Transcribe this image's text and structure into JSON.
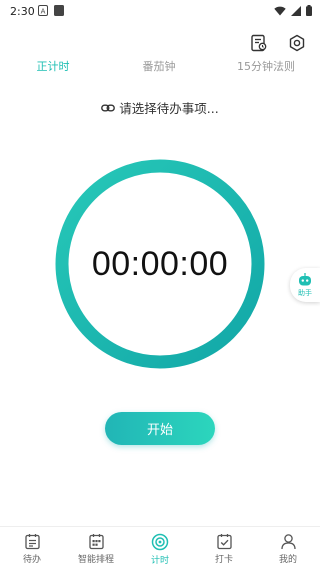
{
  "status_bar": {
    "time": "2:30"
  },
  "tabs": [
    {
      "label": "正计时",
      "active": true
    },
    {
      "label": "番茄钟",
      "active": false
    },
    {
      "label": "15分钟法则",
      "active": false
    }
  ],
  "task_select": {
    "label": "请选择待办事项..."
  },
  "timer": {
    "display": "00:00:00"
  },
  "assistant": {
    "label": "助手"
  },
  "start_button": {
    "label": "开始"
  },
  "bottom_nav": [
    {
      "label": "待办",
      "icon": "todo-icon",
      "active": false
    },
    {
      "label": "智能排程",
      "icon": "calendar-icon",
      "active": false
    },
    {
      "label": "计时",
      "icon": "timer-icon",
      "active": true
    },
    {
      "label": "打卡",
      "icon": "checkin-icon",
      "active": false
    },
    {
      "label": "我的",
      "icon": "profile-icon",
      "active": false
    }
  ],
  "colors": {
    "accent": "#1fbfb3",
    "ring_start": "#1ec3b4",
    "ring_end": "#13a9a8",
    "inactive_text": "#999999"
  }
}
